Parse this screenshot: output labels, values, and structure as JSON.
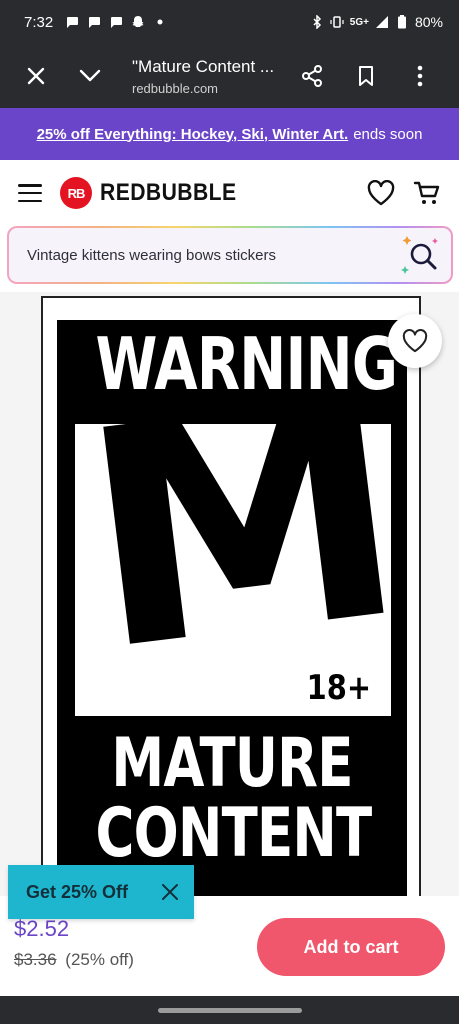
{
  "status_bar": {
    "time": "7:32",
    "network": "5G+",
    "battery": "80%"
  },
  "browser": {
    "page_title": "\"Mature Content ...",
    "domain": "redbubble.com"
  },
  "promo": {
    "link_text": "25% off Everything: Hockey, Ski, Winter Art.",
    "suffix": "ends soon"
  },
  "header": {
    "logo_mark": "RB",
    "logo_text": "REDBUBBLE"
  },
  "search": {
    "query": "Vintage kittens wearing bows stickers"
  },
  "product_image": {
    "top_text": "WARNING",
    "rating_letter": "M",
    "age_label": "18+",
    "line1": "MATURE",
    "line2": "CONTENT"
  },
  "pricing": {
    "price": "$2.52",
    "original_price": "$3.36",
    "discount": "(25% off)"
  },
  "actions": {
    "add_to_cart": "Add to cart",
    "coupon": "Get 25% Off"
  },
  "colors": {
    "brand_red": "#e41321",
    "promo_purple": "#6b45c9",
    "cart_pink": "#f0566c",
    "coupon_teal": "#1eb6cf"
  }
}
